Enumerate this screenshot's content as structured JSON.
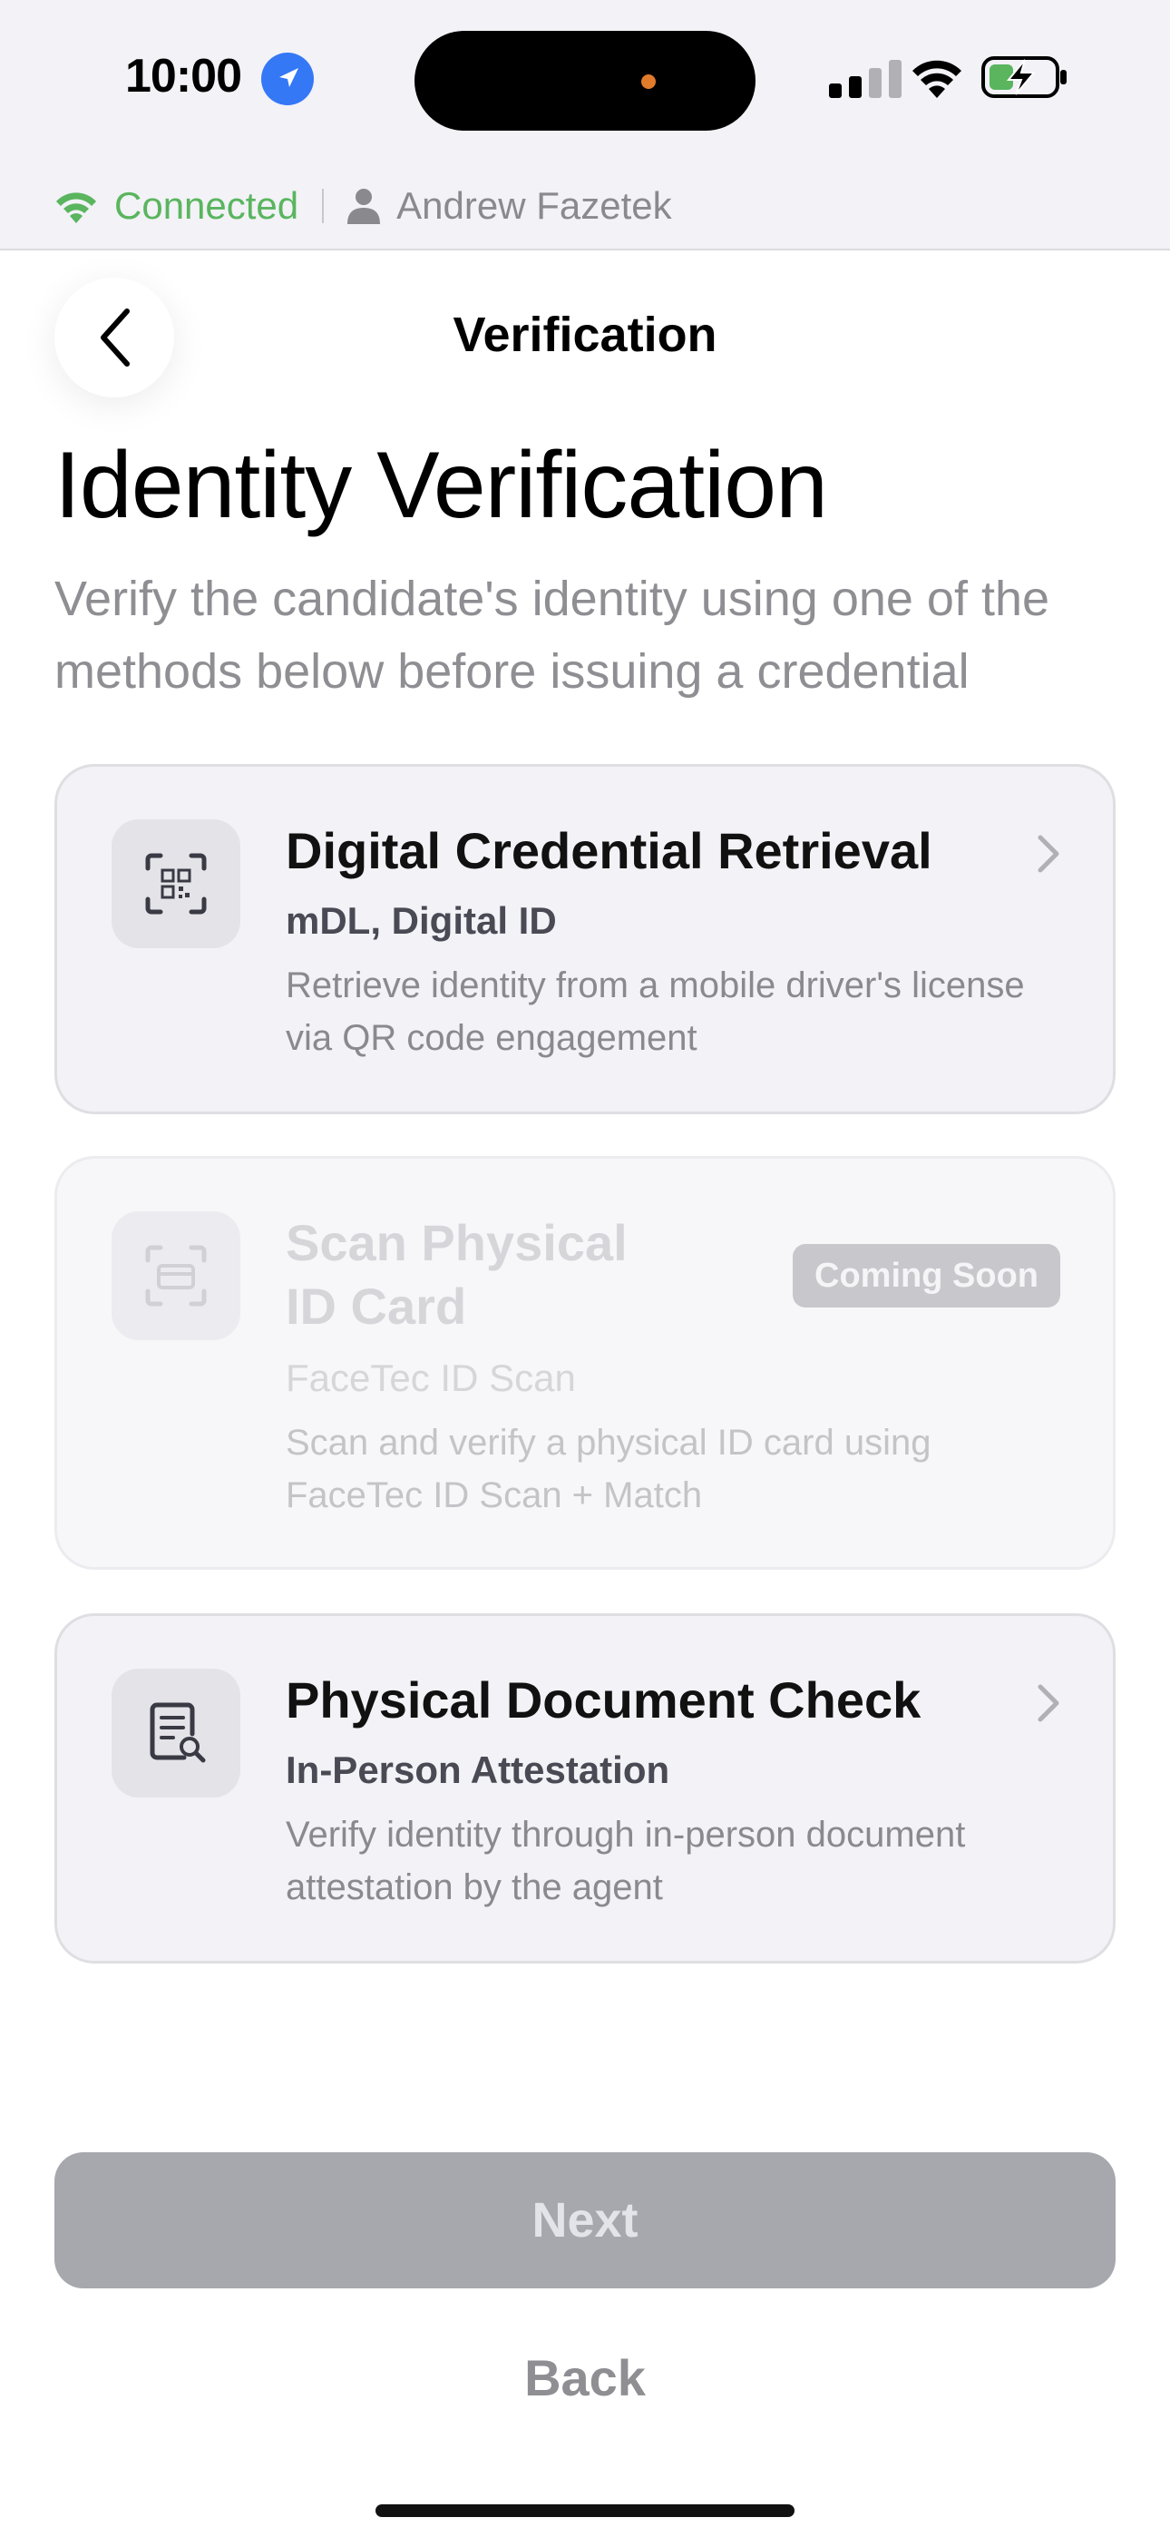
{
  "status_bar": {
    "time": "10:00",
    "connection_status": "Connected",
    "user_name": "Andrew Fazetek"
  },
  "header": {
    "title": "Verification",
    "back_icon": "chevron-left-icon"
  },
  "page": {
    "title": "Identity Verification",
    "subtitle": "Verify the candidate's identity using one of the methods below before issuing a credential"
  },
  "methods": [
    {
      "title": "Digital Credential Retrieval",
      "subtitle": "mDL, Digital ID",
      "description": "Retrieve identity from a mobile driver's license via QR code engagement",
      "icon": "qr-scan-icon",
      "enabled": true
    },
    {
      "title_line1": "Scan Physical",
      "title_line2": "ID Card",
      "subtitle": "FaceTec ID Scan",
      "description": "Scan and verify a physical ID card using FaceTec ID Scan + Match",
      "badge": "Coming Soon",
      "icon": "id-card-scan-icon",
      "enabled": false
    },
    {
      "title": "Physical Document Check",
      "subtitle": "In-Person Attestation",
      "description": "Verify identity through in-person document attestation by the agent",
      "icon": "document-search-icon",
      "enabled": true
    }
  ],
  "actions": {
    "next_label": "Next",
    "back_label": "Back"
  },
  "colors": {
    "connected_green": "#5ab55e",
    "location_blue": "#3478f6",
    "card_bg": "#f2f2f7",
    "next_disabled_bg": "#a6a8ad"
  }
}
